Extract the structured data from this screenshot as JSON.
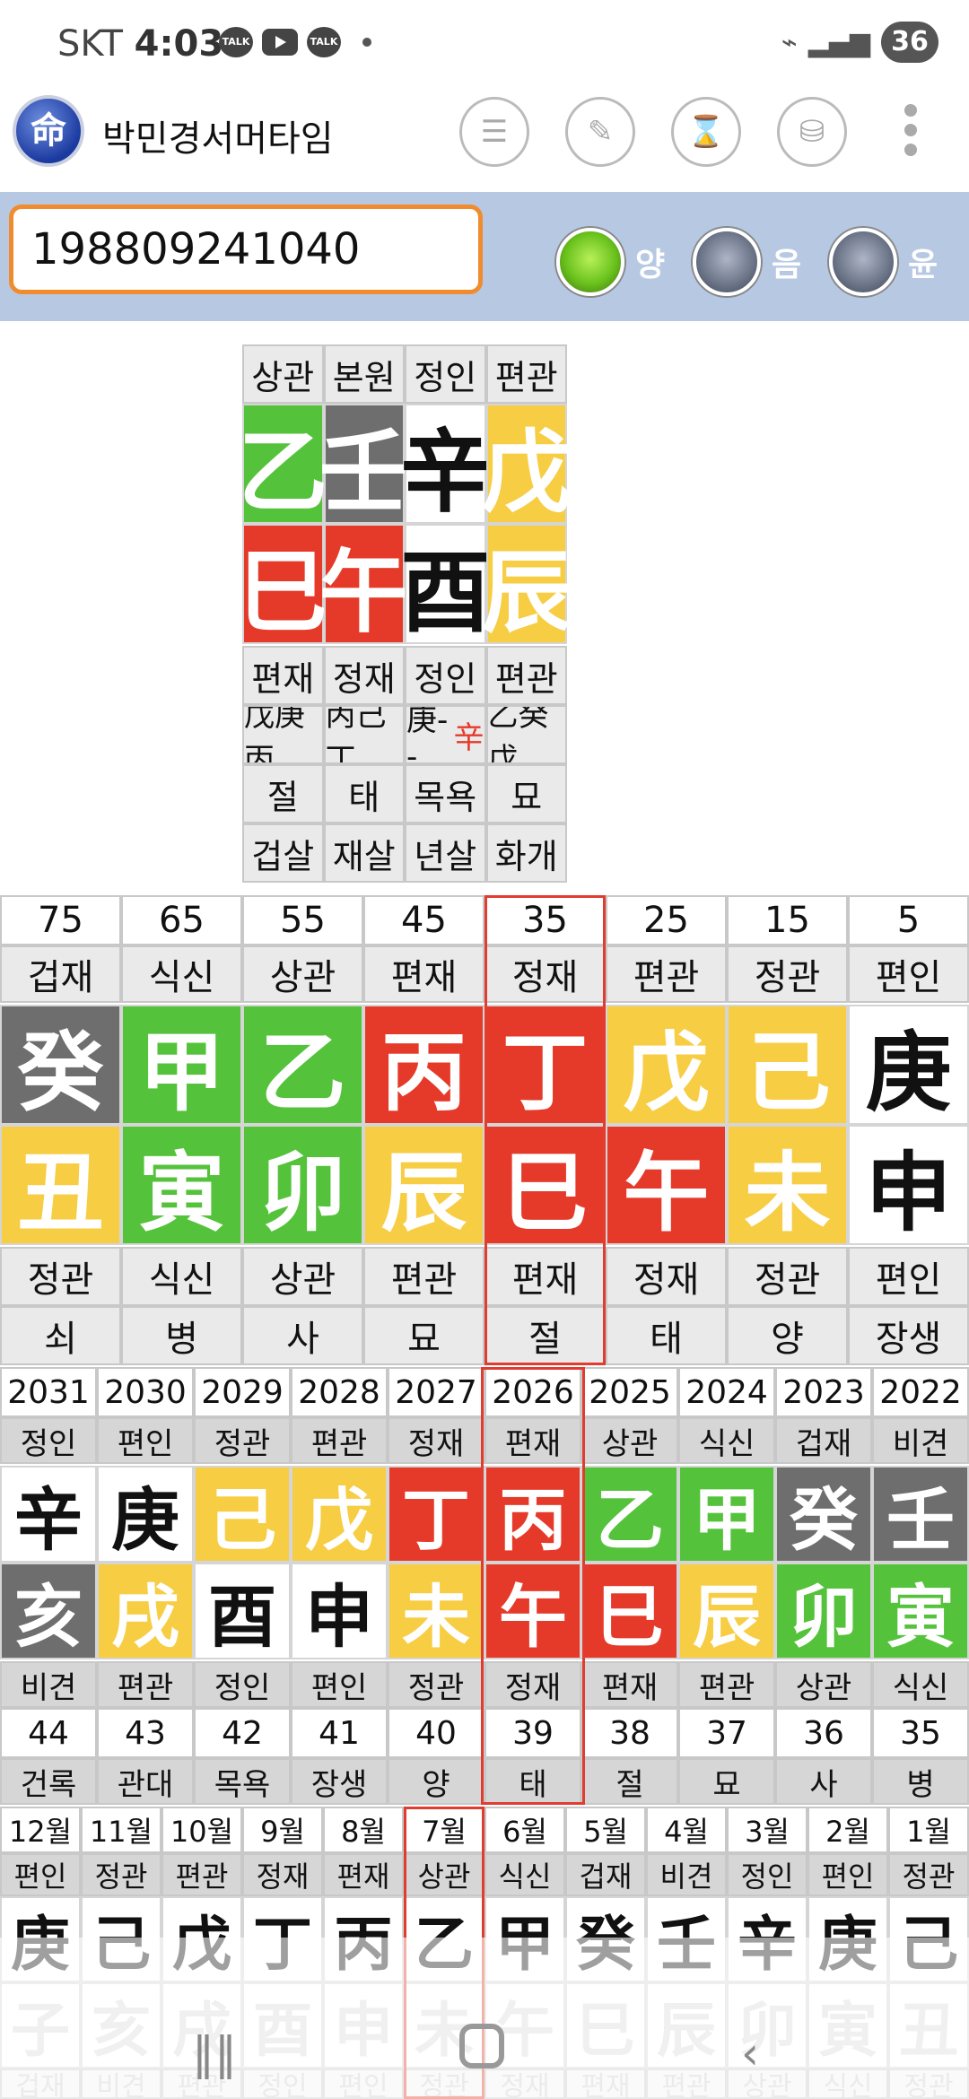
{
  "status": {
    "carrier": "SKT",
    "time": "4:03",
    "talk1": "TALK",
    "talk2": "TALK",
    "battery": "36"
  },
  "app": {
    "logo_char": "命",
    "title": "박민경서머타임"
  },
  "search": {
    "value": "198809241040",
    "radio_labels": [
      "양",
      "음",
      "윤"
    ],
    "selected": 0
  },
  "colors": {
    "green": "#55c23c",
    "gray": "#6e6e6e",
    "white": "#ffffff",
    "yellow": "#f7cd43",
    "red": "#e53a2a",
    "accent": "#f08c2e",
    "header_bg": "#b7c8e3"
  },
  "natal": {
    "top_labels": [
      "상관",
      "본원",
      "정인",
      "편관"
    ],
    "stems": [
      {
        "ch": "乙",
        "c": "green"
      },
      {
        "ch": "壬",
        "c": "gray"
      },
      {
        "ch": "辛",
        "c": "white"
      },
      {
        "ch": "戊",
        "c": "yellow"
      }
    ],
    "branches": [
      {
        "ch": "巳",
        "c": "red"
      },
      {
        "ch": "午",
        "c": "red"
      },
      {
        "ch": "酉",
        "c": "white"
      },
      {
        "ch": "辰",
        "c": "yellow"
      }
    ],
    "row_relation": [
      "편재",
      "정재",
      "정인",
      "편관"
    ],
    "row_hidden": [
      "戊庚丙",
      "丙己丁",
      "庚--",
      "乙癸戊"
    ],
    "hidden_extra": "辛",
    "row_stage": [
      "절",
      "태",
      "목욕",
      "묘"
    ],
    "row_sal": [
      "겁살",
      "재살",
      "년살",
      "화개"
    ]
  },
  "daeun": {
    "ages": [
      "75",
      "65",
      "55",
      "45",
      "35",
      "25",
      "15",
      "5"
    ],
    "top_labels": [
      "겁재",
      "식신",
      "상관",
      "편재",
      "정재",
      "편관",
      "정관",
      "편인"
    ],
    "stems": [
      {
        "ch": "癸",
        "c": "gray"
      },
      {
        "ch": "甲",
        "c": "green"
      },
      {
        "ch": "乙",
        "c": "green"
      },
      {
        "ch": "丙",
        "c": "red"
      },
      {
        "ch": "丁",
        "c": "red"
      },
      {
        "ch": "戊",
        "c": "yellow"
      },
      {
        "ch": "己",
        "c": "yellow"
      },
      {
        "ch": "庚",
        "c": "white"
      }
    ],
    "branches": [
      {
        "ch": "丑",
        "c": "yellow"
      },
      {
        "ch": "寅",
        "c": "green"
      },
      {
        "ch": "卯",
        "c": "green"
      },
      {
        "ch": "辰",
        "c": "yellow"
      },
      {
        "ch": "巳",
        "c": "red"
      },
      {
        "ch": "午",
        "c": "red"
      },
      {
        "ch": "未",
        "c": "yellow"
      },
      {
        "ch": "申",
        "c": "white"
      }
    ],
    "bottom_labels": [
      "정관",
      "식신",
      "상관",
      "편관",
      "편재",
      "정재",
      "정관",
      "편인"
    ],
    "stages": [
      "쇠",
      "병",
      "사",
      "묘",
      "절",
      "태",
      "양",
      "장생"
    ],
    "selected": 4
  },
  "seun": {
    "years": [
      "2031",
      "2030",
      "2029",
      "2028",
      "2027",
      "2026",
      "2025",
      "2024",
      "2023",
      "2022"
    ],
    "top_labels": [
      "정인",
      "편인",
      "정관",
      "편관",
      "정재",
      "편재",
      "상관",
      "식신",
      "겁재",
      "비견"
    ],
    "stems": [
      {
        "ch": "辛",
        "c": "white"
      },
      {
        "ch": "庚",
        "c": "white"
      },
      {
        "ch": "己",
        "c": "yellow"
      },
      {
        "ch": "戊",
        "c": "yellow"
      },
      {
        "ch": "丁",
        "c": "red"
      },
      {
        "ch": "丙",
        "c": "red"
      },
      {
        "ch": "乙",
        "c": "green"
      },
      {
        "ch": "甲",
        "c": "green"
      },
      {
        "ch": "癸",
        "c": "gray"
      },
      {
        "ch": "壬",
        "c": "gray"
      }
    ],
    "branches": [
      {
        "ch": "亥",
        "c": "gray"
      },
      {
        "ch": "戌",
        "c": "yellow"
      },
      {
        "ch": "酉",
        "c": "white"
      },
      {
        "ch": "申",
        "c": "white"
      },
      {
        "ch": "未",
        "c": "yellow"
      },
      {
        "ch": "午",
        "c": "red"
      },
      {
        "ch": "巳",
        "c": "red"
      },
      {
        "ch": "辰",
        "c": "yellow"
      },
      {
        "ch": "卯",
        "c": "green"
      },
      {
        "ch": "寅",
        "c": "green"
      }
    ],
    "bottom_labels": [
      "비견",
      "편관",
      "정인",
      "편인",
      "정관",
      "정재",
      "편재",
      "편관",
      "상관",
      "식신"
    ],
    "ages": [
      "44",
      "43",
      "42",
      "41",
      "40",
      "39",
      "38",
      "37",
      "36",
      "35"
    ],
    "stages": [
      "건록",
      "관대",
      "목욕",
      "장생",
      "양",
      "태",
      "절",
      "묘",
      "사",
      "병"
    ],
    "selected": 5
  },
  "wolun": {
    "months": [
      "12월",
      "11월",
      "10월",
      "9월",
      "8월",
      "7월",
      "6월",
      "5월",
      "4월",
      "3월",
      "2월",
      "1월"
    ],
    "top_labels": [
      "편인",
      "정관",
      "편관",
      "정재",
      "편재",
      "상관",
      "식신",
      "겁재",
      "비견",
      "정인",
      "편인",
      "정관"
    ],
    "stems": [
      "庚",
      "己",
      "戊",
      "丁",
      "丙",
      "乙",
      "甲",
      "癸",
      "壬",
      "辛",
      "庚",
      "己"
    ],
    "branches": [
      "子",
      "亥",
      "戌",
      "酉",
      "申",
      "未",
      "午",
      "巳",
      "辰",
      "卯",
      "寅",
      "丑"
    ],
    "bottom_labels": [
      "겁재",
      "비견",
      "편관",
      "정인",
      "편인",
      "정관",
      "정재",
      "편재",
      "편관",
      "상관",
      "식신",
      "정관"
    ],
    "selected": 5
  }
}
